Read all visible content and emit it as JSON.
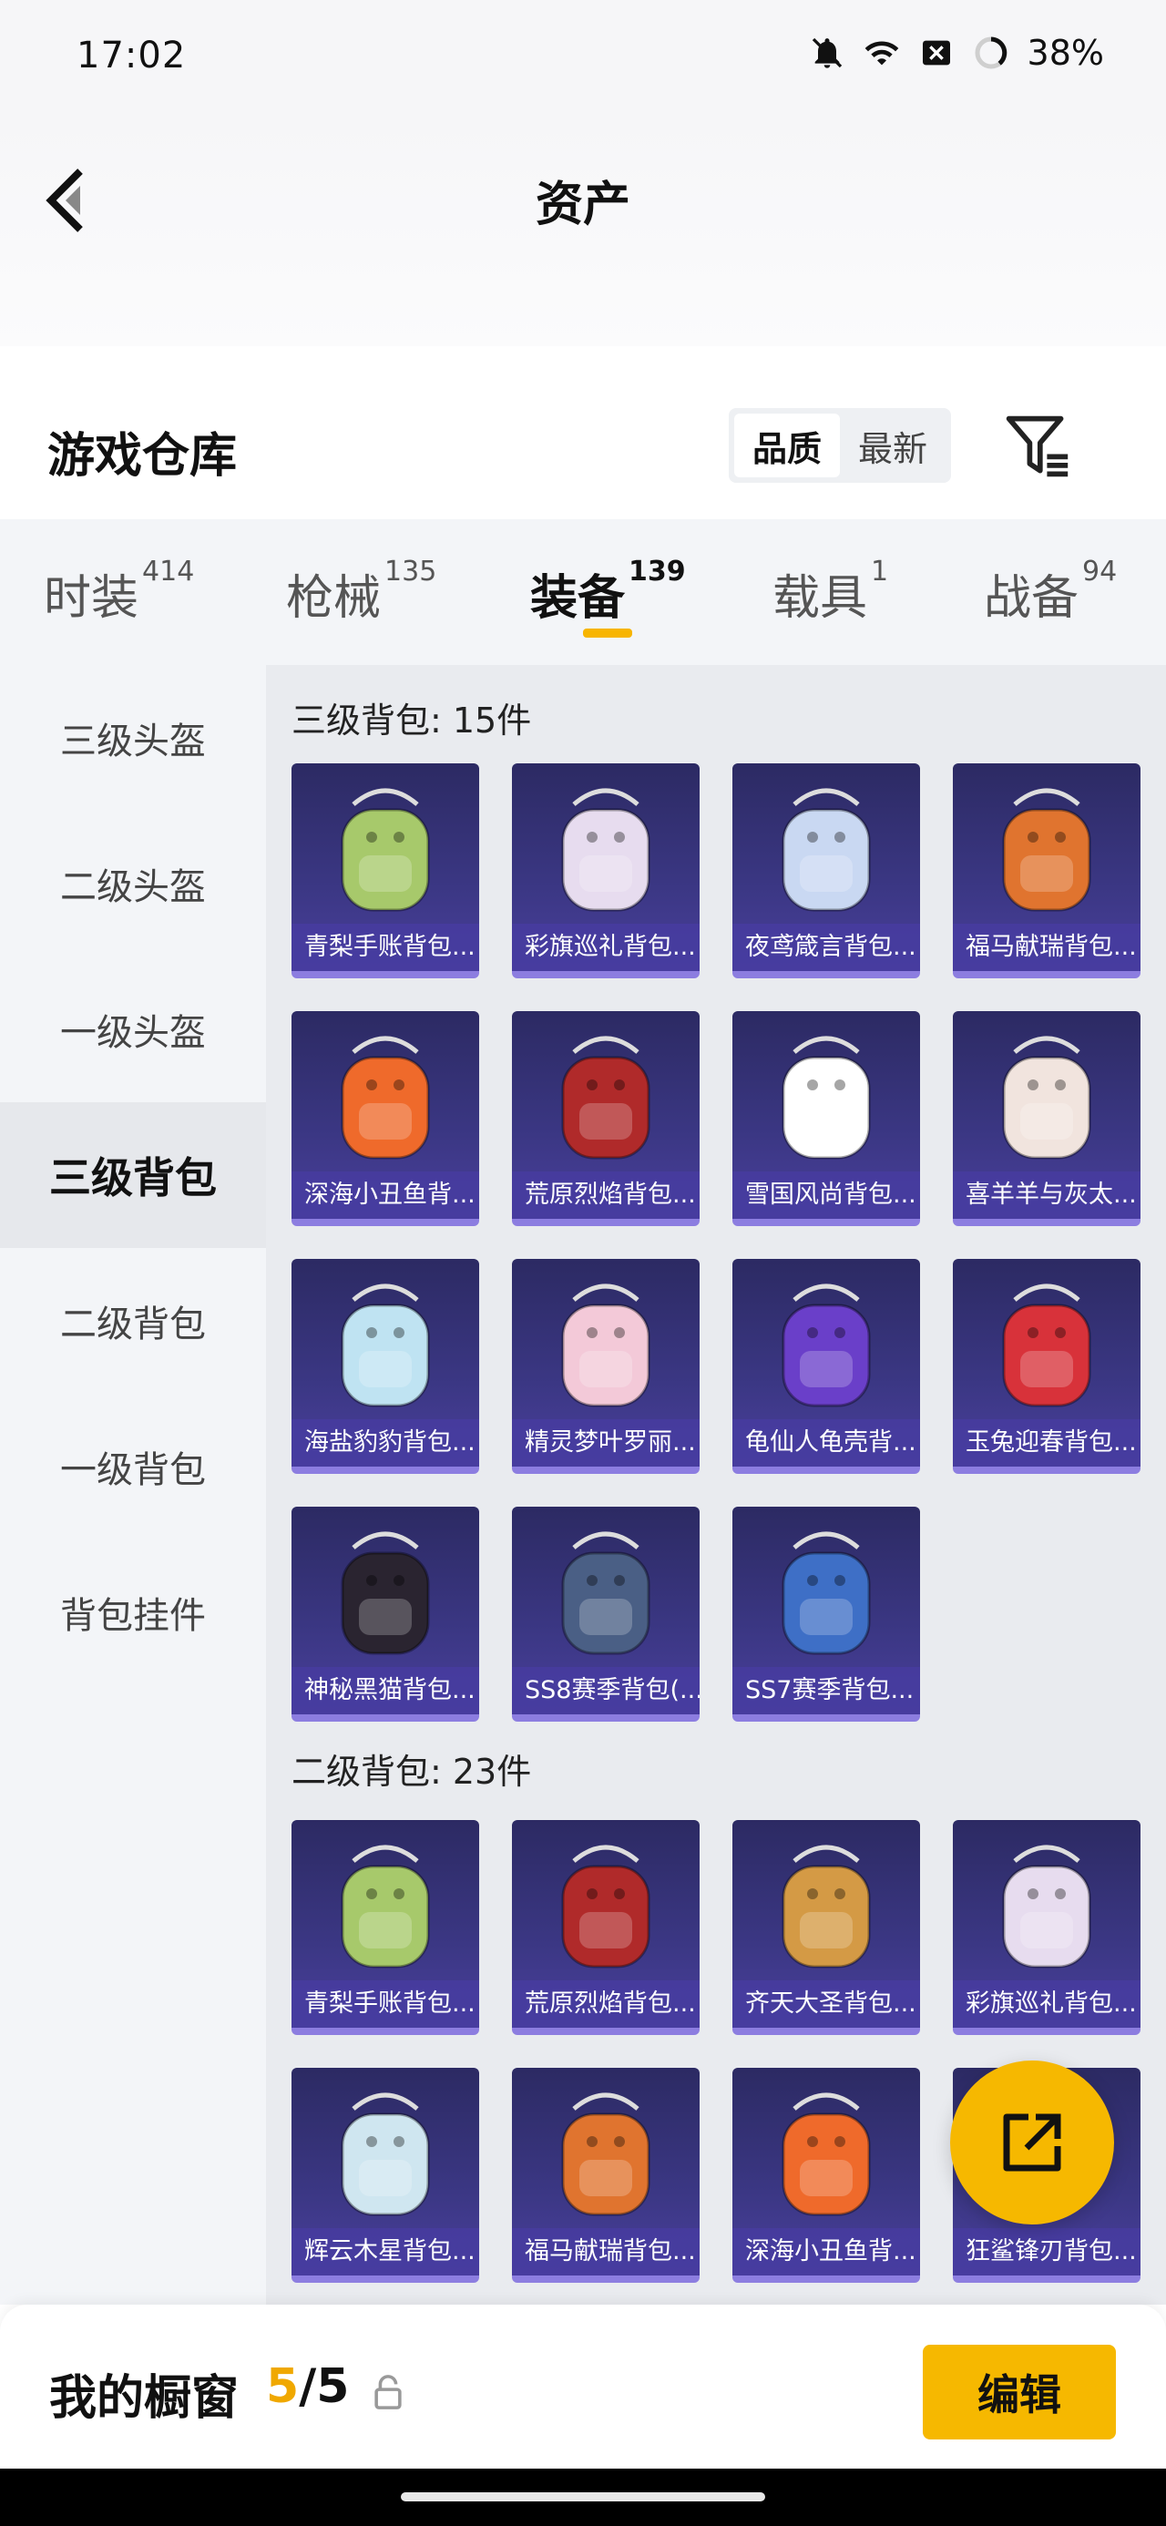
{
  "status": {
    "time": "17:02",
    "battery": "38%",
    "icons": [
      "notifications-off-icon",
      "wifi-icon",
      "close-box-icon",
      "battery-ring-icon"
    ]
  },
  "header": {
    "title": "资产",
    "back_icon": "chevron-left-icon"
  },
  "warehouse": {
    "title": "游戏仓库",
    "sort_options": [
      "品质",
      "最新"
    ],
    "sort_selected": "品质",
    "filter_icon": "filter-icon"
  },
  "tabs": [
    {
      "label": "时装",
      "count": "414"
    },
    {
      "label": "枪械",
      "count": "135"
    },
    {
      "label": "装备",
      "count": "139"
    },
    {
      "label": "载具",
      "count": "1"
    },
    {
      "label": "战备",
      "count": "94"
    }
  ],
  "active_tab": "装备",
  "sidebar": {
    "items": [
      "三级头盔",
      "二级头盔",
      "一级头盔",
      "三级背包",
      "二级背包",
      "一级背包",
      "背包挂件"
    ],
    "active": "三级背包"
  },
  "sections": [
    {
      "title": "三级背包: 15件",
      "items": [
        {
          "name": "青梨手账背包...",
          "color": "#a7c96b"
        },
        {
          "name": "彩旗巡礼背包...",
          "color": "#e7dcef"
        },
        {
          "name": "夜鸢箴言背包...",
          "color": "#c9d8f2"
        },
        {
          "name": "福马献瑞背包...",
          "color": "#e0742f"
        },
        {
          "name": "深海小丑鱼背...",
          "color": "#ef6a2b"
        },
        {
          "name": "荒原烈焰背包...",
          "color": "#b02a2a"
        },
        {
          "name": "雪国风尚背包...",
          "color": "#ffffff"
        },
        {
          "name": "喜羊羊与灰太...",
          "color": "#f1e4de"
        },
        {
          "name": "海盐豹豹背包...",
          "color": "#bfe3f2"
        },
        {
          "name": "精灵梦叶罗丽...",
          "color": "#f3c9d8"
        },
        {
          "name": "龟仙人龟壳背...",
          "color": "#6a3fc9"
        },
        {
          "name": "玉兔迎春背包...",
          "color": "#d8323a"
        },
        {
          "name": "神秘黑猫背包...",
          "color": "#2a2430"
        },
        {
          "name": "SS8赛季背包(...",
          "color": "#4a5f85"
        },
        {
          "name": "SS7赛季背包...",
          "color": "#3e6fc6"
        }
      ]
    },
    {
      "title": "二级背包: 23件",
      "items": [
        {
          "name": "青梨手账背包...",
          "color": "#a7c96b"
        },
        {
          "name": "荒原烈焰背包...",
          "color": "#b02a2a"
        },
        {
          "name": "齐天大圣背包...",
          "color": "#d49a45"
        },
        {
          "name": "彩旗巡礼背包...",
          "color": "#e7dcef"
        },
        {
          "name": "辉云木星背包...",
          "color": "#cfe6f0"
        },
        {
          "name": "福马献瑞背包...",
          "color": "#e0742f"
        },
        {
          "name": "深海小丑鱼背...",
          "color": "#ef6a2b"
        },
        {
          "name": "狂鲨锋刃背包...",
          "color": "#5a6a8a"
        }
      ]
    }
  ],
  "fab_icon": "share-external-icon",
  "bottom_bar": {
    "title": "我的橱窗",
    "count_current": "5",
    "count_sep": "/",
    "count_total": "5",
    "lock_icon": "lock-icon",
    "edit_label": "编辑"
  }
}
